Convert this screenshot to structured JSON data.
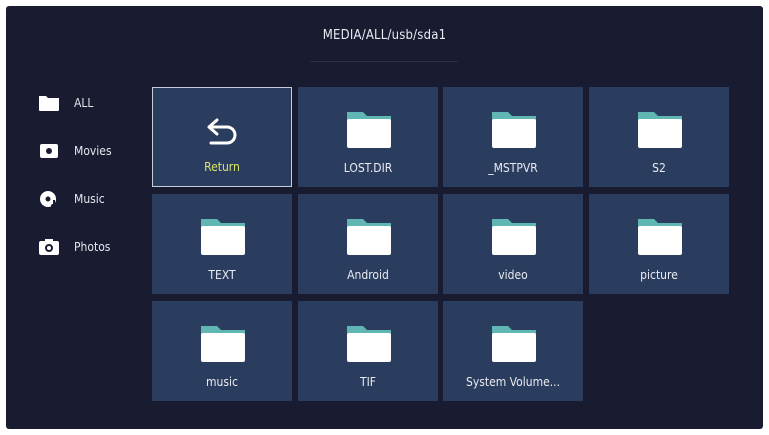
{
  "header": {
    "path": "MEDIA/ALL/usb/sda1"
  },
  "sidebar": {
    "items": [
      {
        "label": "ALL",
        "icon": "folder-icon"
      },
      {
        "label": "Movies",
        "icon": "movie-icon"
      },
      {
        "label": "Music",
        "icon": "music-icon"
      },
      {
        "label": "Photos",
        "icon": "camera-icon"
      }
    ]
  },
  "grid": {
    "tiles": [
      {
        "label": "Return",
        "icon": "return-icon",
        "selected": true
      },
      {
        "label": "LOST.DIR",
        "icon": "folder-icon"
      },
      {
        "label": "_MSTPVR",
        "icon": "folder-icon"
      },
      {
        "label": "S2",
        "icon": "folder-icon"
      },
      {
        "label": "TEXT",
        "icon": "folder-icon"
      },
      {
        "label": "Android",
        "icon": "folder-icon"
      },
      {
        "label": "video",
        "icon": "folder-icon"
      },
      {
        "label": "picture",
        "icon": "folder-icon"
      },
      {
        "label": "music",
        "icon": "folder-icon"
      },
      {
        "label": "TIF",
        "icon": "folder-icon"
      },
      {
        "label": "System Volume...",
        "icon": "folder-icon"
      }
    ]
  },
  "colors": {
    "background": "#191b30",
    "tile": "#2b3d5e",
    "selected_label": "#d9e46a",
    "folder_tab": "#5fb6b3"
  }
}
